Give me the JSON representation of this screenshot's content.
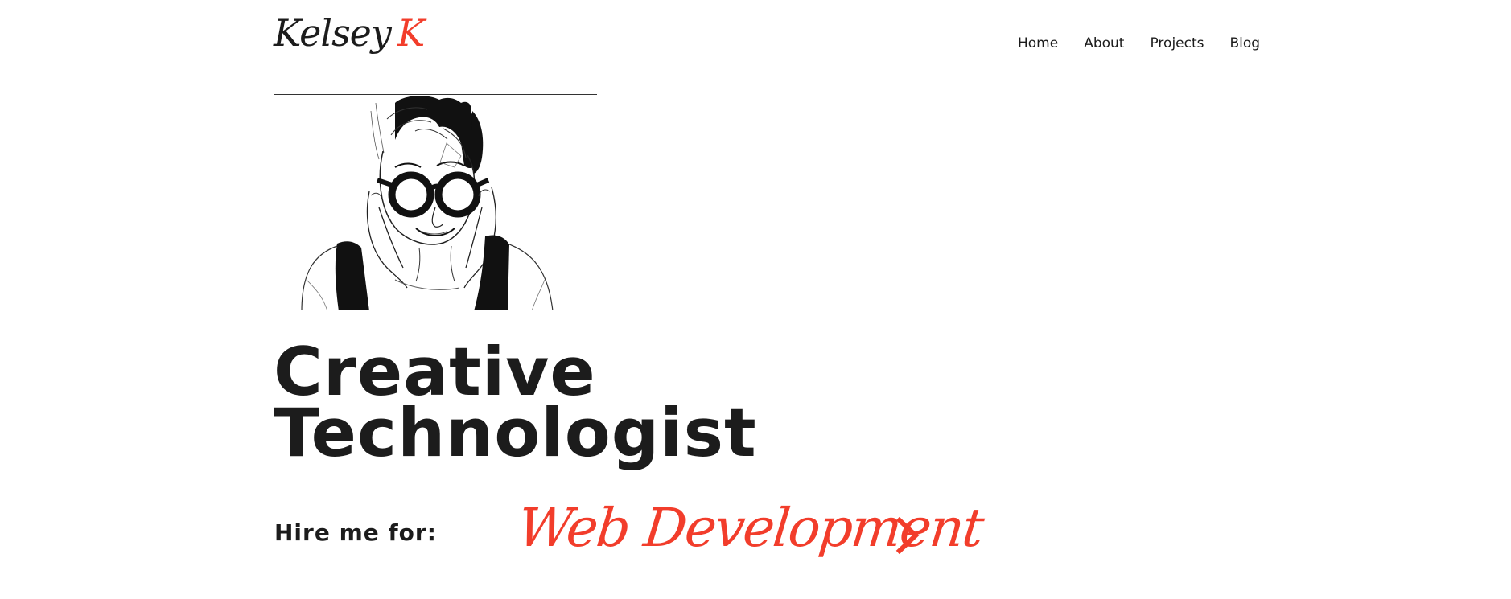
{
  "brand": {
    "name": "Kelsey",
    "initial": "K",
    "accent_color": "#f23d2b",
    "text_color": "#1c1c1c"
  },
  "nav": {
    "items": [
      {
        "label": "Home"
      },
      {
        "label": "About"
      },
      {
        "label": "Projects"
      },
      {
        "label": "Blog"
      }
    ]
  },
  "hero": {
    "portrait_icon": "sketch-portrait-icon",
    "headline_line1": "Creative",
    "headline_line2": "Technologist"
  },
  "hire": {
    "label": "Hire me for:",
    "service": "Web Development",
    "next_icon": "chevron-right-icon"
  }
}
